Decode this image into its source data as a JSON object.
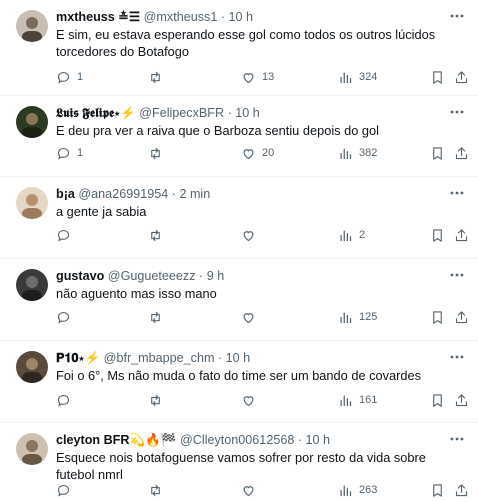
{
  "tweets": [
    {
      "name": "mxtheuss ≛☰",
      "handle": "@mxtheuss1",
      "time": "10 h",
      "text": "E sim, eu estava esperando esse gol como todos os outros lúcidos torcedores do Botafogo",
      "replies": "1",
      "retweets": "",
      "likes": "13",
      "views": "324",
      "avatar_color": "#8a7a6a"
    },
    {
      "name": "𝕷𝖚𝖎𝖘 𝕱𝖊𝖑𝖎𝖕𝖊⋆⚡",
      "handle": "@FelipecxBFR",
      "time": "10 h",
      "text": "E deu pra ver a raiva que o Barboza sentiu depois do gol",
      "replies": "1",
      "retweets": "",
      "likes": "20",
      "views": "382",
      "avatar_color": "#3b4a2f"
    },
    {
      "name": "b¡a",
      "handle": "@ana26991954",
      "time": "2 min",
      "text": "a gente ja sabia",
      "replies": "",
      "retweets": "",
      "likes": "",
      "views": "2",
      "avatar_color": "#c9a98a"
    },
    {
      "name": "gustavo",
      "handle": "@Gugueteeezz",
      "time": "9 h",
      "text": "não aguento mas isso mano",
      "replies": "",
      "retweets": "",
      "likes": "",
      "views": "125",
      "avatar_color": "#2c2c2c"
    },
    {
      "name": "𝐏𝟏𝟎⋆⚡",
      "handle": "@bfr_mbappe_chm",
      "time": "10 h",
      "text": "Foi o 6°, Ms não muda o fato do time ser um bando de covardes",
      "replies": "",
      "retweets": "",
      "likes": "",
      "views": "161",
      "avatar_color": "#6b5a4a"
    },
    {
      "name": "cleyton BFR💫🔥🏁",
      "handle": "@Clleyton00612568",
      "time": "10 h",
      "text": "Esquece nois botafoguense vamos sofrer por resto da vida sobre futebol nmrl",
      "replies": "",
      "retweets": "",
      "likes": "",
      "views": "263",
      "avatar_color": "#a58f7a"
    }
  ],
  "separator": "·"
}
